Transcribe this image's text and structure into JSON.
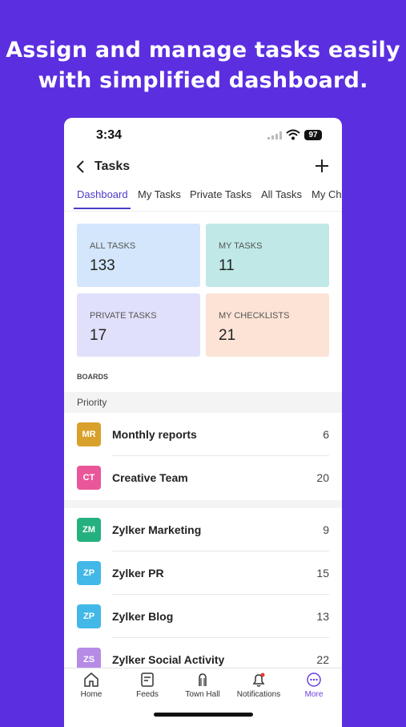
{
  "headline": {
    "line1": "Assign and manage tasks easily",
    "line2": "with simplified dashboard."
  },
  "status_bar": {
    "time": "3:34",
    "battery": "97"
  },
  "nav": {
    "title": "Tasks",
    "back_icon": "chevron-left-icon",
    "add_icon": "plus-icon"
  },
  "tabs": [
    {
      "label": "Dashboard",
      "active": true
    },
    {
      "label": "My Tasks"
    },
    {
      "label": "Private Tasks"
    },
    {
      "label": "All Tasks"
    },
    {
      "label": "My Ch"
    }
  ],
  "cards": [
    {
      "label": "ALL TASKS",
      "value": "133",
      "color": "#d3e6fb"
    },
    {
      "label": "MY TASKS",
      "value": "11",
      "color": "#bfe8e6"
    },
    {
      "label": "PRIVATE TASKS",
      "value": "17",
      "color": "#e1e0fb"
    },
    {
      "label": "MY CHECKLISTS",
      "value": "21",
      "color": "#fde3d5"
    }
  ],
  "boards": {
    "heading": "BOARDS",
    "section": "Priority",
    "items": [
      {
        "initials": "MR",
        "name": "Monthly reports",
        "count": "6",
        "color": "#d9a12c"
      },
      {
        "initials": "CT",
        "name": "Creative Team",
        "count": "20",
        "color": "#e9579a"
      },
      {
        "initials": "ZM",
        "name": "Zylker Marketing",
        "count": "9",
        "color": "#25b07f"
      },
      {
        "initials": "ZP",
        "name": "Zylker PR",
        "count": "15",
        "color": "#42b8e8"
      },
      {
        "initials": "ZP",
        "name": "Zylker Blog",
        "count": "13",
        "color": "#42b8e8"
      },
      {
        "initials": "ZS",
        "name": "Zylker Social Activity",
        "count": "22",
        "color": "#b58be6"
      }
    ]
  },
  "bottom_nav": [
    {
      "label": "Home",
      "icon": "home-icon"
    },
    {
      "label": "Feeds",
      "icon": "feeds-icon"
    },
    {
      "label": "Town Hall",
      "icon": "town-hall-icon"
    },
    {
      "label": "Notifications",
      "icon": "bell-icon"
    },
    {
      "label": "More",
      "icon": "more-icon",
      "active": true
    }
  ],
  "colors": {
    "background": "#5b2ee0",
    "accent": "#4a3cc9",
    "more_active": "#6a3fe0"
  }
}
